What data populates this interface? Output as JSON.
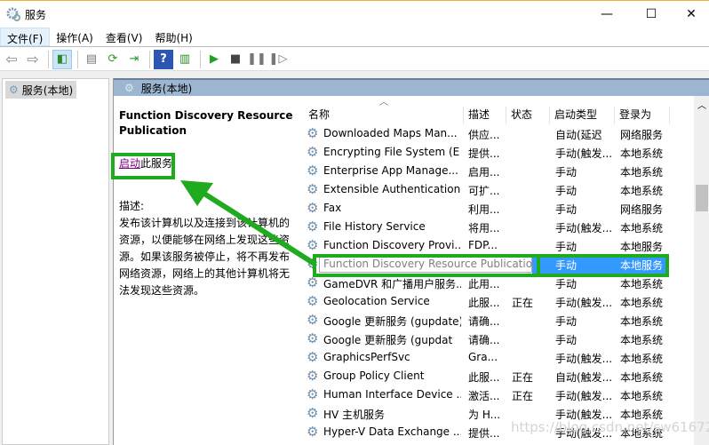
{
  "window": {
    "title": "服务",
    "icon": "services-gear-icon",
    "controls": {
      "minimize": "—",
      "maximize": "☐",
      "close": "✕"
    }
  },
  "menu": [
    {
      "label": "文件(F)",
      "active": true
    },
    {
      "label": "操作(A)"
    },
    {
      "label": "查看(V)"
    },
    {
      "label": "帮助(H)"
    }
  ],
  "toolbar": [
    "back-icon",
    "forward-icon",
    "show-hide-tree-icon",
    "properties-icon",
    "refresh-icon",
    "export-list-icon",
    "help-icon",
    "console-icon",
    "start-service-icon",
    "stop-service-icon",
    "pause-service-icon",
    "restart-service-icon"
  ],
  "tree": {
    "item": "服务(本地)"
  },
  "right": {
    "header": "服务(本地)",
    "detail": {
      "title": "Function Discovery Resource Publication",
      "start_link": "启动",
      "start_suffix": "此服务",
      "desc_label": "描述:",
      "desc_text": "发布该计算机以及连接到该计算机的资源，以便能够在网络上发现这些资源。如果该服务被停止，将不再发布网络资源，网络上的其他计算机将无法发现这些资源。"
    },
    "columns": [
      "名称",
      "描述",
      "状态",
      "启动类型",
      "登录为"
    ],
    "rows": [
      [
        "Downloaded Maps Man...",
        "供应...",
        "",
        "自动(延迟",
        "网络服务"
      ],
      [
        "Encrypting File System (E",
        "提供...",
        "",
        "手动(触发...",
        "本地系统"
      ],
      [
        "Enterprise App Manage...",
        "启用...",
        "",
        "手动",
        "本地系统"
      ],
      [
        "Extensible Authentication...",
        "可扩...",
        "",
        "手动",
        "本地系统"
      ],
      [
        "Fax",
        "利用...",
        "",
        "手动",
        "网络服务"
      ],
      [
        "File History Service",
        "将用...",
        "",
        "手动(触发...",
        "本地系统"
      ],
      [
        "Function Discovery Provi...",
        "FDP...",
        "",
        "手动",
        "本地服务"
      ],
      [
        "Function Discovery Resource Publication",
        "",
        "",
        "手动",
        "本地服务"
      ],
      [
        "GameDVR 和广播用户服务...",
        "此用...",
        "",
        "手动",
        "本地系统"
      ],
      [
        "Geolocation Service",
        "此服...",
        "正在",
        "手动(触发...",
        "本地系统"
      ],
      [
        "Google 更新服务 (gupdate)",
        "请确...",
        "",
        "手动",
        "本地系统"
      ],
      [
        "Google 更新服务 (gupdat",
        "请确...",
        "",
        "手动",
        "本地系统"
      ],
      [
        "GraphicsPerfSvc",
        "Gra...",
        "",
        "手动(触发...",
        "本地系统"
      ],
      [
        "Group Policy Client",
        "此服...",
        "正在",
        "自动(触发...",
        "本地系统"
      ],
      [
        "Human Interface Device ...",
        "激活...",
        "正在",
        "手动(触发...",
        "本地系统"
      ],
      [
        "HV 主机服务",
        "为 H...",
        "",
        "手动(触发...",
        "本地系统"
      ],
      [
        "Hyper-V Data Exchange ...",
        "提供...",
        "",
        "手动(触发...",
        "本地系统"
      ]
    ],
    "selected_index": 7
  },
  "annotation_color": "#1faa1f",
  "selection_color": "#3399ff",
  "watermark": "https://blog.csdn.net/sw616729"
}
